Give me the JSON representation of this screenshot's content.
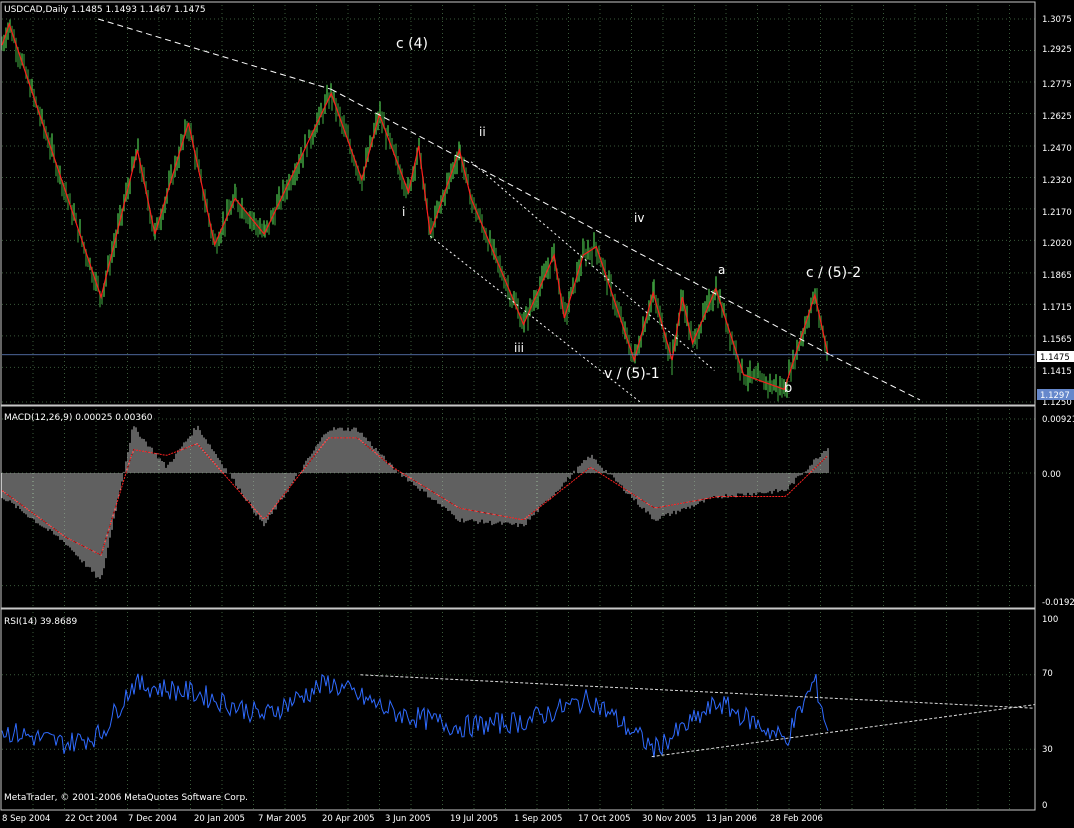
{
  "colors": {
    "background": "#000000",
    "grid": "#3a5a3a",
    "frame": "#c8c8c8",
    "text": "#ffffff",
    "bull_bar": "#3c9a3c",
    "bear_bar": "#2a6f2a",
    "zigzag": "#ff1c1c",
    "macd_hist": "#c0c0c0",
    "macd_signal": "#ff2020",
    "rsi": "#2f6bff",
    "trendline": "#ffffff",
    "price_line": "#6688cc"
  },
  "price_panel": {
    "title": "USDCAD,Daily  1.1485 1.1493 1.1467 1.1475",
    "ylim": [
      1.125,
      1.3075
    ],
    "ticks": [
      "1.3075",
      "1.2925",
      "1.2775",
      "1.2625",
      "1.2470",
      "1.2320",
      "1.2170",
      "1.2020",
      "1.1865",
      "1.1715",
      "1.1565",
      "1.1415",
      "1.1250"
    ],
    "current_price": "1.1475",
    "low_marker": "1.1297"
  },
  "macd_panel": {
    "title": "MACD(12,26,9) 0.00025 0.00360",
    "ylim": [
      -0.0192,
      0.00921
    ],
    "ticks": [
      "0.00921",
      "0.00",
      "-0.0192"
    ]
  },
  "rsi_panel": {
    "title": "RSI(14) 39.8689",
    "ylim": [
      0,
      100
    ],
    "ticks": [
      "100",
      "70",
      "30",
      "0"
    ]
  },
  "copyright": "MetaTrader, © 2001-2006 MetaQuotes Software Corp.",
  "x_axis_labels": [
    "8 Sep 2004",
    "22 Oct 2004",
    "7 Dec 2004",
    "20 Jan 2005",
    "7 Mar 2005",
    "20 Apr 2005",
    "3 Jun 2005",
    "19 Jul 2005",
    "1 Sep 2005",
    "17 Oct 2005",
    "30 Nov 2005",
    "13 Jan 2006",
    "28 Feb 2006"
  ],
  "wave_labels": [
    "c (4)",
    "i",
    "ii",
    "iii",
    "iv",
    "v / (5)-1",
    "a",
    "b",
    "c / (5)-2"
  ],
  "chart_data": {
    "type": "line",
    "title": "USDCAD,Daily",
    "x_range": [
      "8 Sep 2004",
      "Mar 2006"
    ],
    "price_pivots": {
      "x": [
        "8 Sep 2004",
        "13 Sep 2004",
        "15 Nov 2004",
        "10 Dec 2004",
        "22 Dec 2004",
        "14 Jan 2005",
        "1 Feb 2005",
        "15 Feb 2005",
        "7 Mar 2005",
        "22 Apr 2005",
        "13 May 2005",
        "25 May 2005",
        "14 Jun 2005",
        "21 Jun 2005",
        "29 Jun 2005",
        "19 Jul 2005",
        "27 Jul 2005",
        "1 Sep 2005",
        "22 Sep 2005",
        "29 Sep 2005",
        "12 Oct 2005",
        "21 Oct 2005",
        "16 Nov 2005",
        "29 Nov 2005",
        "12 Dec 2005",
        "19 Dec 2005",
        "26 Dec 2005",
        "11 Jan 2006",
        "30 Jan 2006",
        "27 Feb 2006",
        "20 Mar 2006",
        "29 Mar 2006"
      ],
      "y": [
        1.295,
        1.305,
        1.175,
        1.245,
        1.205,
        1.258,
        1.2,
        1.222,
        1.205,
        1.272,
        1.231,
        1.262,
        1.225,
        1.247,
        1.205,
        1.245,
        1.222,
        1.162,
        1.195,
        1.165,
        1.195,
        1.199,
        1.145,
        1.177,
        1.145,
        1.175,
        1.153,
        1.179,
        1.138,
        1.131,
        1.176,
        1.1475
      ]
    },
    "macd": {
      "x": [
        "8 Sep 2004",
        "22 Oct 2004",
        "15 Nov 2004",
        "7 Dec 2004",
        "30 Dec 2004",
        "20 Jan 2005",
        "7 Mar 2005",
        "20 Apr 2005",
        "10 May 2005",
        "3 Jun 2005",
        "19 Jul 2005",
        "1 Sep 2005",
        "17 Oct 2005",
        "30 Nov 2005",
        "13 Jan 2006",
        "28 Feb 2006",
        "29 Mar 2006"
      ],
      "values": [
        -0.004,
        -0.012,
        -0.0185,
        0.008,
        0.001,
        0.008,
        -0.009,
        0.0075,
        0.0075,
        0.001,
        -0.008,
        -0.009,
        0.003,
        -0.008,
        -0.004,
        -0.003,
        0.0045
      ],
      "signal": [
        -0.003,
        -0.011,
        -0.014,
        0.004,
        0.003,
        0.005,
        -0.008,
        0.006,
        0.006,
        0.001,
        -0.006,
        -0.008,
        0.001,
        -0.006,
        -0.004,
        -0.004,
        0.003
      ]
    },
    "rsi": {
      "x": [
        "8 Sep 2004",
        "22 Oct 2004",
        "15 Nov 2004",
        "7 Dec 2004",
        "20 Jan 2005",
        "7 Mar 2005",
        "20 Apr 2005",
        "3 Jun 2005",
        "19 Jul 2005",
        "1 Sep 2005",
        "17 Oct 2005",
        "30 Nov 2005",
        "13 Jan 2006",
        "28 Feb 2006",
        "20 Mar 2006",
        "29 Mar 2006"
      ],
      "values": [
        40,
        33,
        38,
        65,
        60,
        48,
        66,
        50,
        42,
        45,
        57,
        30,
        55,
        35,
        67,
        40
      ]
    },
    "rsi_levels": [
      70,
      30
    ]
  }
}
